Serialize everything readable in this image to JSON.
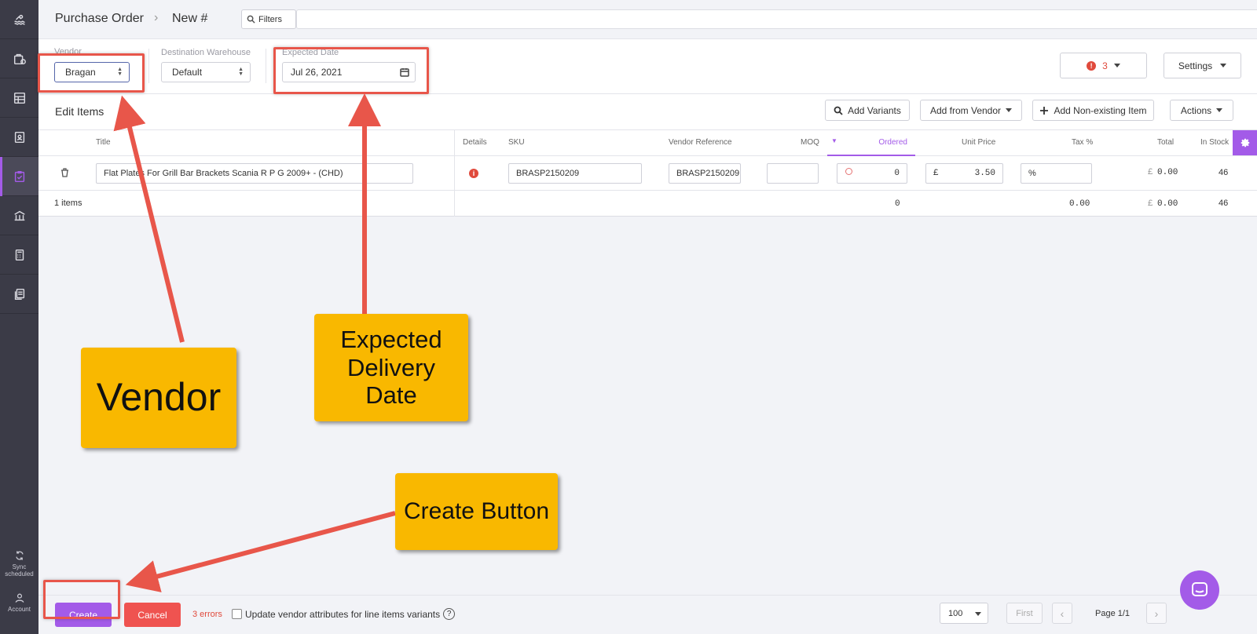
{
  "breadcrumb": {
    "root": "Purchase Order",
    "separator": "›",
    "current": "New #"
  },
  "filters": {
    "label": "Filters",
    "value": ""
  },
  "fields": {
    "vendor": {
      "label": "Vendor",
      "value": "Bragan"
    },
    "warehouse": {
      "label": "Destination Warehouse",
      "value": "Default"
    },
    "expected_date": {
      "label": "Expected Date",
      "value": "Jul 26, 2021"
    }
  },
  "header_actions": {
    "errors_count": "3",
    "settings_label": "Settings"
  },
  "edit_items": {
    "title": "Edit Items",
    "buttons": {
      "add_variants": "Add Variants",
      "add_from_vendor": "Add from Vendor",
      "add_non_existing": "Add Non-existing Item",
      "actions": "Actions"
    }
  },
  "table": {
    "headers": {
      "title": "Title",
      "details": "Details",
      "sku": "SKU",
      "vendor_reference": "Vendor Reference",
      "moq": "MOQ",
      "ordered": "Ordered",
      "unit_price": "Unit Price",
      "tax": "Tax %",
      "total": "Total",
      "in_stock": "In Stock"
    },
    "rows": [
      {
        "title": "Flat Plates For Grill Bar Brackets Scania R P G 2009+ - (CHD)",
        "sku": "BRASP2150209",
        "vendor_reference": "BRASP2150209",
        "moq": "",
        "ordered": "0",
        "currency": "£",
        "unit_price": "3.50",
        "tax_placeholder": "%",
        "total": "0.00",
        "in_stock": "46"
      }
    ],
    "footer": {
      "items_count": "1 items",
      "ordered_total": "0",
      "tax_total": "0.00",
      "currency": "£",
      "grand_total": "0.00",
      "stock_total": "46"
    }
  },
  "bottom": {
    "create_label": "Create",
    "cancel_label": "Cancel",
    "errors_text": "3 errors",
    "checkbox_label": "Update vendor attributes for line items variants",
    "help": "?",
    "page_size": "100",
    "first_label": "First",
    "prev": "‹",
    "next": "›",
    "page_info": "Page 1/1"
  },
  "rail": {
    "sync_label_1": "Sync",
    "sync_label_2": "scheduled",
    "account_label": "Account"
  },
  "annotations": {
    "vendor": "Vendor",
    "expected_line1": "Expected",
    "expected_line2": "Delivery",
    "expected_line3": "Date",
    "create": "Create Button"
  },
  "colors": {
    "accent": "#a35be8",
    "danger": "#ef5350",
    "callout": "#f9b800",
    "highlight": "#e8564a",
    "rail": "#3b3b47"
  }
}
